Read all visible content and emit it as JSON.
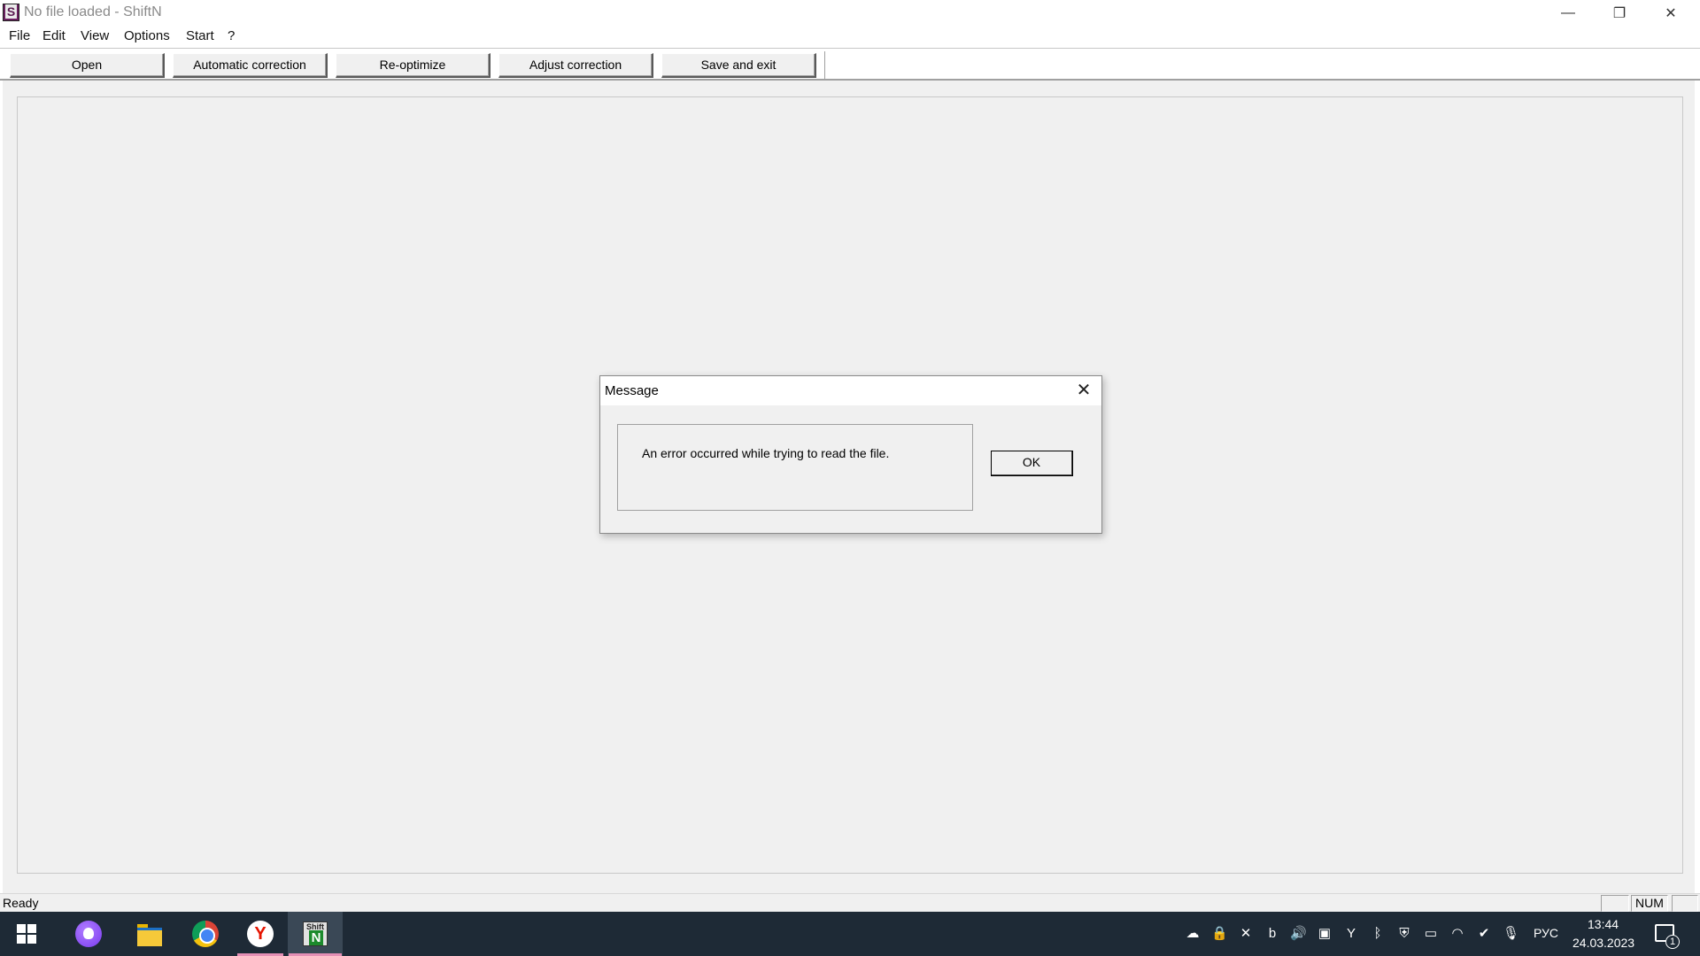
{
  "window": {
    "title": "No file loaded - ShiftN",
    "minimize": "—",
    "restore": "❐",
    "close": "✕"
  },
  "menu": [
    "File",
    "Edit",
    "View",
    "Options",
    "Start",
    "?"
  ],
  "toolbar": {
    "open": "Open",
    "automatic_correction": "Automatic correction",
    "reoptimize": "Re-optimize",
    "adjust_correction": "Adjust correction",
    "save_and_exit": "Save and exit"
  },
  "dialog": {
    "title": "Message",
    "message": "An error occurred while trying to read the file.",
    "ok": "OK",
    "close": "✕"
  },
  "statusbar": {
    "text": "Ready",
    "num": "NUM"
  },
  "taskbar": {
    "apps": [
      "start-icon",
      "alice-icon",
      "file-explorer-icon",
      "chrome-icon",
      "yandex-browser-icon",
      "shiftn-icon"
    ],
    "shiftn_label_top": "Shift",
    "shiftn_label_n": "N",
    "yandex_letter": "Y",
    "language": "РУС",
    "time": "13:44",
    "date": "24.03.2023",
    "notifications": "1",
    "accent": "#e48fb5"
  }
}
